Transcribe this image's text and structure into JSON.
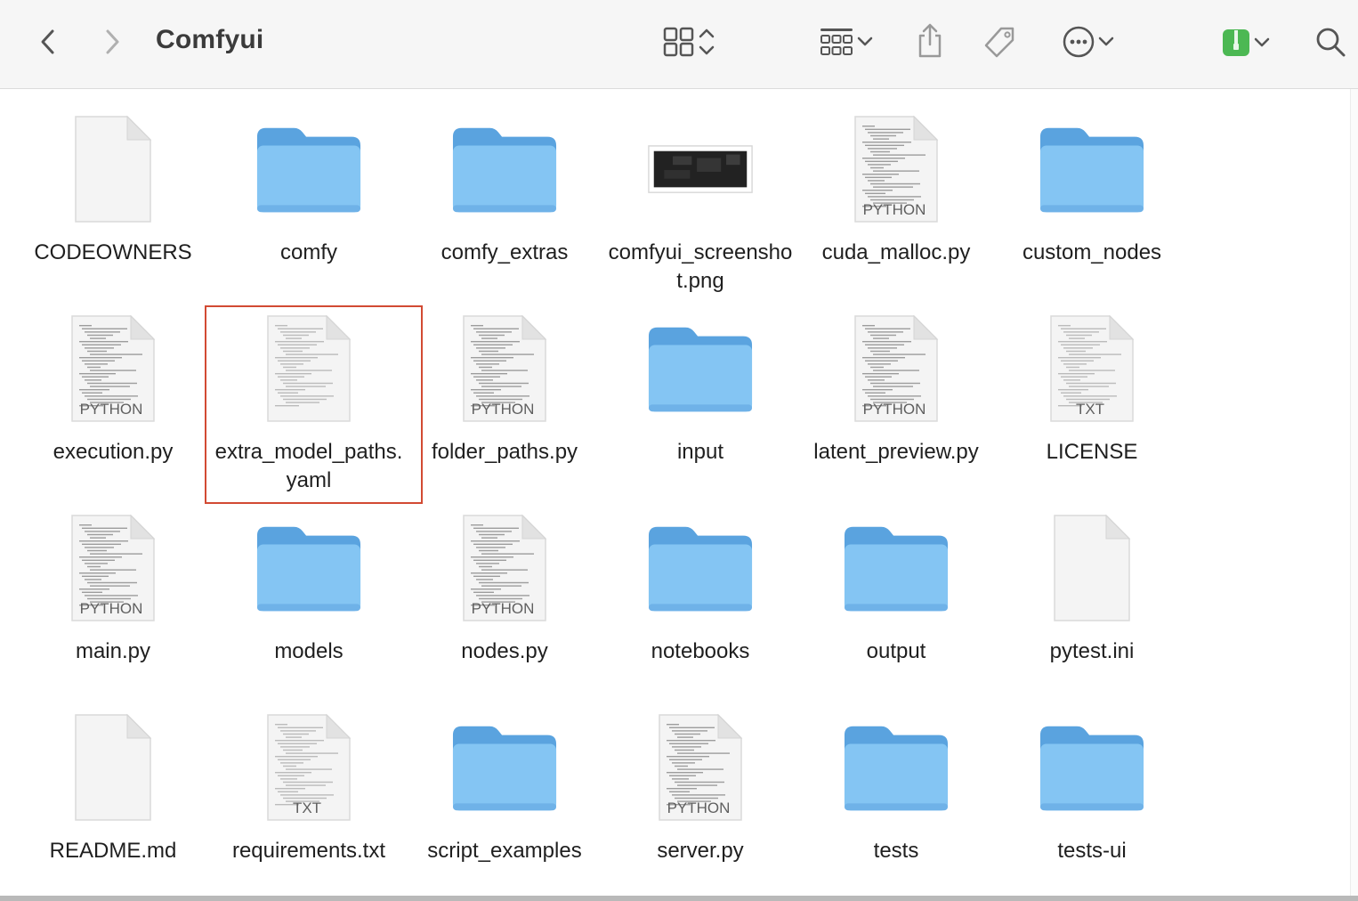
{
  "window": {
    "title": "Comfyui"
  },
  "toolbar": {
    "back_icon": "chevron-left-icon",
    "forward_icon": "chevron-right-icon",
    "view_icon": "icon-grid-view-icon",
    "group_icon": "group-by-icon",
    "share_icon": "share-icon",
    "tag_icon": "tag-icon",
    "more_icon": "ellipsis-circle-icon",
    "app_icon": "zip-archive-icon",
    "search_icon": "search-icon"
  },
  "colors": {
    "folder_body": "#84c5f3",
    "folder_tab": "#5aa3df",
    "selection_outline": "#d24a33",
    "app_icon_green": "#4cb853"
  },
  "items": [
    {
      "name": "CODEOWNERS",
      "kind": "blank"
    },
    {
      "name": "comfy",
      "kind": "folder"
    },
    {
      "name": "comfy_extras",
      "kind": "folder"
    },
    {
      "name": "comfyui_screenshot.png",
      "kind": "image"
    },
    {
      "name": "cuda_malloc.py",
      "kind": "doc",
      "badge": "PYTHON"
    },
    {
      "name": "custom_nodes",
      "kind": "folder"
    },
    {
      "name": "execution.py",
      "kind": "doc",
      "badge": "PYTHON"
    },
    {
      "name": "extra_model_paths.yaml",
      "kind": "doc",
      "badge": "",
      "selected": true
    },
    {
      "name": "folder_paths.py",
      "kind": "doc",
      "badge": "PYTHON"
    },
    {
      "name": "input",
      "kind": "folder"
    },
    {
      "name": "latent_preview.py",
      "kind": "doc",
      "badge": "PYTHON"
    },
    {
      "name": "LICENSE",
      "kind": "doc",
      "badge": "TXT"
    },
    {
      "name": "main.py",
      "kind": "doc",
      "badge": "PYTHON"
    },
    {
      "name": "models",
      "kind": "folder"
    },
    {
      "name": "nodes.py",
      "kind": "doc",
      "badge": "PYTHON"
    },
    {
      "name": "notebooks",
      "kind": "folder"
    },
    {
      "name": "output",
      "kind": "folder"
    },
    {
      "name": "pytest.ini",
      "kind": "blank"
    },
    {
      "name": "README.md",
      "kind": "blank"
    },
    {
      "name": "requirements.txt",
      "kind": "doc",
      "badge": "TXT"
    },
    {
      "name": "script_examples",
      "kind": "folder"
    },
    {
      "name": "server.py",
      "kind": "doc",
      "badge": "PYTHON"
    },
    {
      "name": "tests",
      "kind": "folder"
    },
    {
      "name": "tests-ui",
      "kind": "folder"
    }
  ]
}
